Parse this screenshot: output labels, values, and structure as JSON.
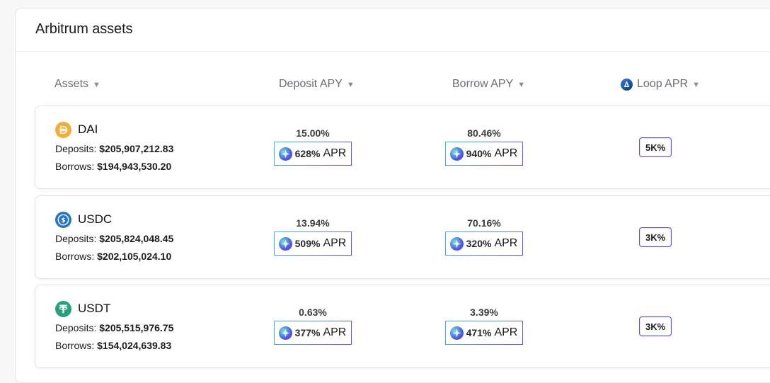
{
  "panel": {
    "title": "Arbitrum assets"
  },
  "columns": {
    "assets": "Assets",
    "deposit_apy": "Deposit APY",
    "borrow_apy": "Borrow APY",
    "loop_apr": "Loop APR",
    "sort_glyph": "▼"
  },
  "labels": {
    "deposits": "Deposits:",
    "borrows": "Borrows:",
    "apr": "APR"
  },
  "colors": {
    "accent_gradient_start": "#2dc6d6",
    "accent_gradient_end": "#7a3cf0",
    "dai": "#f5ac37",
    "usdc": "#2775ca",
    "usdt": "#26a17b"
  },
  "rows": [
    {
      "name": "DAI",
      "icon": "dai-coin-icon",
      "deposits": "$205,907,212.83",
      "borrows": "$194,943,530.20",
      "deposit_apy": "15.00%",
      "deposit_apr": "628%",
      "borrow_apy": "80.46%",
      "borrow_apr": "940%",
      "loop_apr": "5K%"
    },
    {
      "name": "USDC",
      "icon": "usdc-coin-icon",
      "deposits": "$205,824,048.45",
      "borrows": "$202,105,024.10",
      "deposit_apy": "13.94%",
      "deposit_apr": "509%",
      "borrow_apy": "70.16%",
      "borrow_apr": "320%",
      "loop_apr": "3K%"
    },
    {
      "name": "USDT",
      "icon": "usdt-coin-icon",
      "deposits": "$205,515,976.75",
      "borrows": "$154,024,639.83",
      "deposit_apy": "0.63%",
      "deposit_apr": "377%",
      "borrow_apy": "3.39%",
      "borrow_apr": "471%",
      "loop_apr": "3K%"
    }
  ]
}
